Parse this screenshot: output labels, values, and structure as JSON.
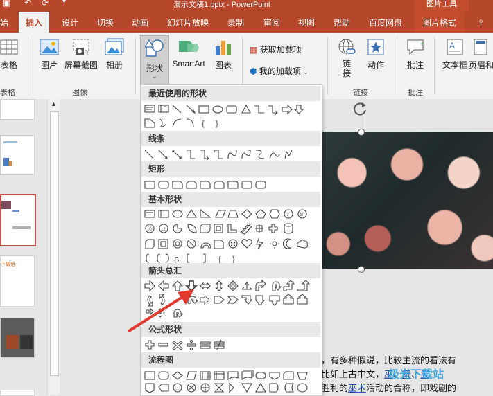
{
  "title_bar": {
    "document_title": "演示文稿1.pptx  -  PowerPoint",
    "context_tools": "图片工具"
  },
  "tabs": [
    {
      "label": "始"
    },
    {
      "label": "插入"
    },
    {
      "label": "设计"
    },
    {
      "label": "切换"
    },
    {
      "label": "动画"
    },
    {
      "label": "幻灯片放映"
    },
    {
      "label": "录制"
    },
    {
      "label": "审阅"
    },
    {
      "label": "视图"
    },
    {
      "label": "帮助"
    },
    {
      "label": "百度网盘"
    },
    {
      "label": "图片格式"
    }
  ],
  "ribbon": {
    "table": "表格",
    "table_group": "表格",
    "picture": "图片",
    "screenshot": "屏幕截图",
    "album": "相册",
    "image_group": "图像",
    "shapes": "形状",
    "smartart": "SmartArt",
    "chart": "图表",
    "get_addins": "获取加载项",
    "my_addins": "我的加载项",
    "link": "链接",
    "action": "动作",
    "link_group": "链接",
    "comment": "批注",
    "comment_group": "批注",
    "textbox": "文本框",
    "header_footer": "页眉和"
  },
  "shapes_menu": {
    "sections": [
      {
        "label": "最近使用的形状"
      },
      {
        "label": "线条"
      },
      {
        "label": "矩形"
      },
      {
        "label": "基本形状"
      },
      {
        "label": "箭头总汇"
      },
      {
        "label": "公式形状"
      },
      {
        "label": "流程图"
      }
    ]
  },
  "slide_thumbs": {
    "thumb4_text": "下做给"
  },
  "doc_text": {
    "line1": "，有多种假说，比较主流的看法有",
    "line2a": "比如上古中文，",
    "line2b": "巫",
    "line2c": "、",
    "line2d": "舞",
    "line2e": "、",
    "line2f": "武",
    "line3a": "胜利的",
    "line3b": "巫术",
    "line3c": "活动的合称，即戏剧的"
  },
  "watermark": "极光下载站",
  "colors": {
    "accent": "#b7472a",
    "arrow": "#e03a2e"
  }
}
